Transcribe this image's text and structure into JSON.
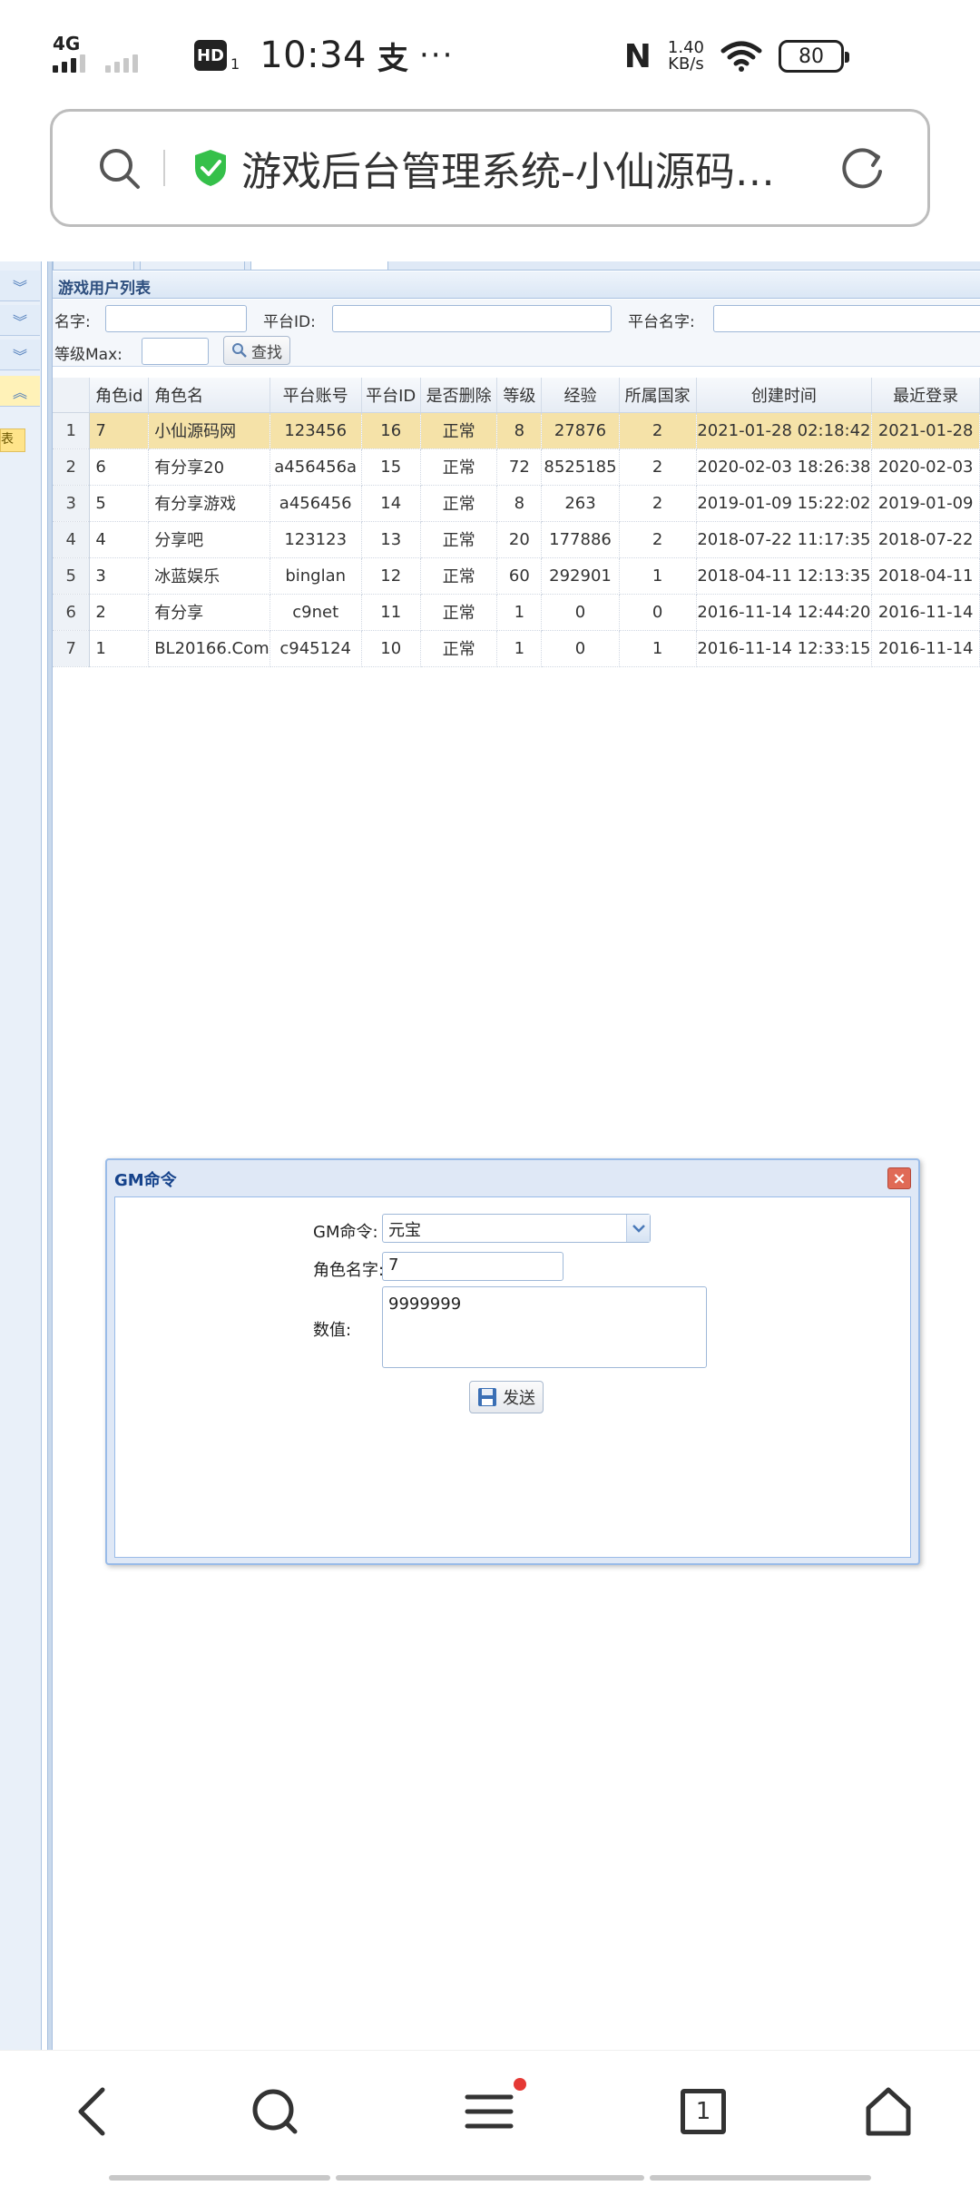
{
  "status_bar": {
    "network": "4G",
    "hd": "HD",
    "hd_sub": "1",
    "time": "10:34",
    "app_glyph": "支",
    "more": "···",
    "nfc": "N",
    "speed_value": "1.40",
    "speed_unit": "KB/s",
    "battery": "80"
  },
  "url_bar": {
    "title": "游戏后台管理系统-小仙源码…"
  },
  "panel": {
    "title": "游戏用户列表"
  },
  "toolbar": {
    "name_label": "名字:",
    "platform_id_label": "平台ID:",
    "platform_name_label": "平台名字:",
    "level_max_label": "等级Max:",
    "search_label": "查找"
  },
  "left_panel": {
    "item_label": "表"
  },
  "table": {
    "columns": [
      "角色id",
      "角色名",
      "平台账号",
      "平台ID",
      "是否删除",
      "等级",
      "经验",
      "所属国家",
      "创建时间",
      "最近登录"
    ],
    "rows": [
      {
        "n": "1",
        "cells": [
          "7",
          "小仙源码网",
          "123456",
          "16",
          "正常",
          "8",
          "27876",
          "2",
          "2021-01-28 02:18:42",
          "2021-01-28"
        ]
      },
      {
        "n": "2",
        "cells": [
          "6",
          "有分享20",
          "a456456a",
          "15",
          "正常",
          "72",
          "8525185",
          "2",
          "2020-02-03 18:26:38",
          "2020-02-03"
        ]
      },
      {
        "n": "3",
        "cells": [
          "5",
          "有分享游戏",
          "a456456",
          "14",
          "正常",
          "8",
          "263",
          "2",
          "2019-01-09 15:22:02",
          "2019-01-09"
        ]
      },
      {
        "n": "4",
        "cells": [
          "4",
          "分享吧",
          "123123",
          "13",
          "正常",
          "20",
          "177886",
          "2",
          "2018-07-22 11:17:35",
          "2018-07-22"
        ]
      },
      {
        "n": "5",
        "cells": [
          "3",
          "冰蓝娱乐",
          "binglan",
          "12",
          "正常",
          "60",
          "292901",
          "1",
          "2018-04-11 12:13:35",
          "2018-04-11"
        ]
      },
      {
        "n": "6",
        "cells": [
          "2",
          "有分享",
          "c9net",
          "11",
          "正常",
          "1",
          "0",
          "0",
          "2016-11-14 12:44:20",
          "2016-11-14"
        ]
      },
      {
        "n": "7",
        "cells": [
          "1",
          "BL20166.Com",
          "c945124",
          "10",
          "正常",
          "1",
          "0",
          "1",
          "2016-11-14 12:33:15",
          "2016-11-14"
        ]
      }
    ]
  },
  "dialog": {
    "title": "GM命令",
    "command_label": "GM命令:",
    "command_value": "元宝",
    "role_label": "角色名字:",
    "role_value": "7",
    "amount_label": "数值:",
    "amount_value": "9999999",
    "send_label": "发送"
  },
  "nav": {
    "tabs_count": "1"
  }
}
